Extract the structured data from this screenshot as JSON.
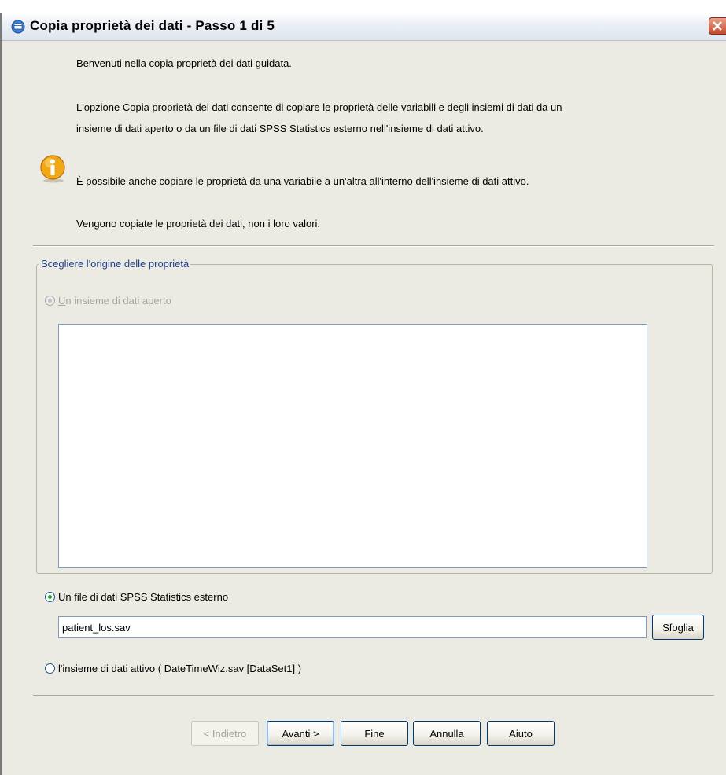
{
  "window": {
    "title": "Copia proprietà dei dati - Passo 1 di 5"
  },
  "intro": {
    "welcome": "Benvenuti nella copia proprietà dei dati guidata.",
    "description_line1": "L'opzione Copia proprietà dei dati consente di copiare le   proprietà delle variabili e degli insiemi di dati da un",
    "description_line2": "insieme di dati aperto o da un file di dati SPSS Statistics esterno nell'insieme di dati attivo.",
    "also_possible": "È possibile anche copiare le proprietà da una variabile a un'altra all'interno dell'insieme di dati attivo.",
    "note": "Vengono copiate le proprietà dei dati, non i loro valori.",
    "icon": "info-icon"
  },
  "source_group": {
    "legend": "Scegliere l'origine delle proprietà",
    "option_open_dataset": {
      "label": "Un insieme di dati aperto",
      "selected": false,
      "enabled": false
    },
    "open_dataset_list": [],
    "option_external_file": {
      "label": "Un file di dati SPSS Statistics esterno",
      "selected": true,
      "enabled": true
    },
    "file_value": "patient_los.sav",
    "browse_label": "Sfoglia",
    "option_active_dataset": {
      "label": "l'insieme di dati attivo ( DateTimeWiz.sav [DataSet1] )",
      "selected": false,
      "enabled": true
    }
  },
  "buttons": {
    "back": "< Indietro",
    "next": "Avanti >",
    "finish": "Fine",
    "cancel": "Annulla",
    "help": "Aiuto"
  },
  "colors": {
    "dialog_bg": "#ecebe3",
    "group_legend": "#1f3f8a",
    "close_button": "#c9482c"
  }
}
